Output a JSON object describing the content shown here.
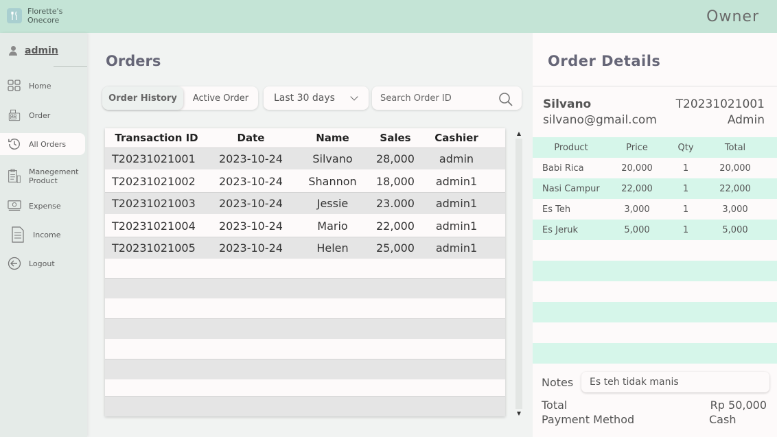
{
  "brand": {
    "name": "Florette's Onecore",
    "logo_icon": "fork-knife-icon"
  },
  "header": {
    "role": "Owner"
  },
  "sidebar": {
    "user": "admin",
    "items": [
      {
        "label": "Home",
        "icon": "grid-icon"
      },
      {
        "label": "Order",
        "icon": "cash-register-icon"
      },
      {
        "label": "All Orders",
        "icon": "history-icon",
        "active": true
      },
      {
        "label": "Manegement Product",
        "icon": "clipboard-icon"
      },
      {
        "label": "Expense",
        "icon": "money-icon"
      },
      {
        "label": "Income",
        "icon": "document-icon"
      },
      {
        "label": "Logout",
        "icon": "logout-icon"
      }
    ]
  },
  "main": {
    "title": "Orders",
    "tabs": [
      {
        "label": "Order History",
        "active": true
      },
      {
        "label": "Active Order"
      }
    ],
    "filter": {
      "selected": "Last 30 days"
    },
    "search": {
      "placeholder": "Search Order ID",
      "value": ""
    },
    "table": {
      "columns": [
        "Transaction ID",
        "Date",
        "Name",
        "Sales",
        "Cashier"
      ],
      "rows": [
        [
          "T20231021001",
          "2023-10-24",
          "Silvano",
          "28,000",
          "admin"
        ],
        [
          "T20231021002",
          "2023-10-24",
          "Shannon",
          "18,000",
          "admin1"
        ],
        [
          "T20231021003",
          "2023-10-24",
          "Jessie",
          "23.000",
          "admin1"
        ],
        [
          "T20231021004",
          "2023-10-24",
          "Mario",
          "22,000",
          "admin1"
        ],
        [
          "T20231021005",
          "2023-10-24",
          "Helen",
          "25,000",
          "admin1"
        ]
      ]
    }
  },
  "details": {
    "title": "Order Details",
    "customer": {
      "name": "Silvano",
      "email": "silvano@gmail.com"
    },
    "transaction_id": "T20231021001",
    "cashier_role": "Admin",
    "columns": [
      "Product",
      "Price",
      "Qty",
      "Total"
    ],
    "items": [
      [
        "Babi Rica",
        "20,000",
        "1",
        "20,000"
      ],
      [
        "Nasi Campur",
        "22,000",
        "1",
        "22,000"
      ],
      [
        "Es Teh",
        "3,000",
        "1",
        "3,000"
      ],
      [
        "Es Jeruk",
        "5,000",
        "1",
        "5,000"
      ]
    ],
    "notes_label": "Notes",
    "notes_value": "Es teh tidak manis",
    "total_label": "Total",
    "total_value": "Rp 50,000",
    "payment_label": "Payment Method",
    "payment_value": "Cash"
  },
  "colors": {
    "topbar": "#c4e4d6",
    "mint_row": "#d6f6ea",
    "sidebar": "#e5ebe8",
    "panel": "#fdfafa"
  }
}
